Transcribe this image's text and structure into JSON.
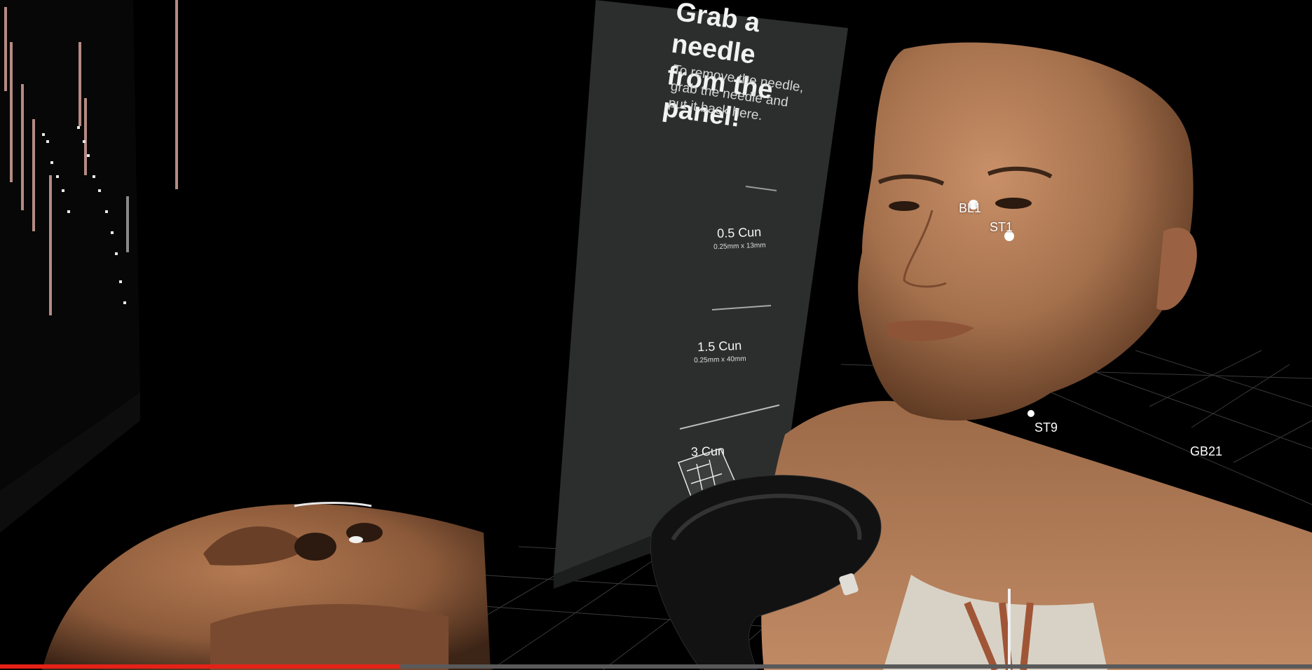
{
  "panel": {
    "title": "Grab a needle from the panel!",
    "instruction": "To remove the needle, grab the needle and put it back here."
  },
  "needles": [
    {
      "name": "0.5 Cun",
      "spec": "0.25mm x 13mm"
    },
    {
      "name": "1.5 Cun",
      "spec": "0.25mm x 40mm"
    },
    {
      "name": "3 Cun",
      "spec": ""
    }
  ],
  "acupoints": [
    {
      "label": "BL1"
    },
    {
      "label": "ST1"
    },
    {
      "label": "ST9"
    },
    {
      "label": "GB21"
    }
  ],
  "video": {
    "progress": 0.305
  },
  "colors": {
    "background": "#000000",
    "panel": "#2c2e2e",
    "skin": "#b9825a",
    "progress": "#e62117"
  }
}
